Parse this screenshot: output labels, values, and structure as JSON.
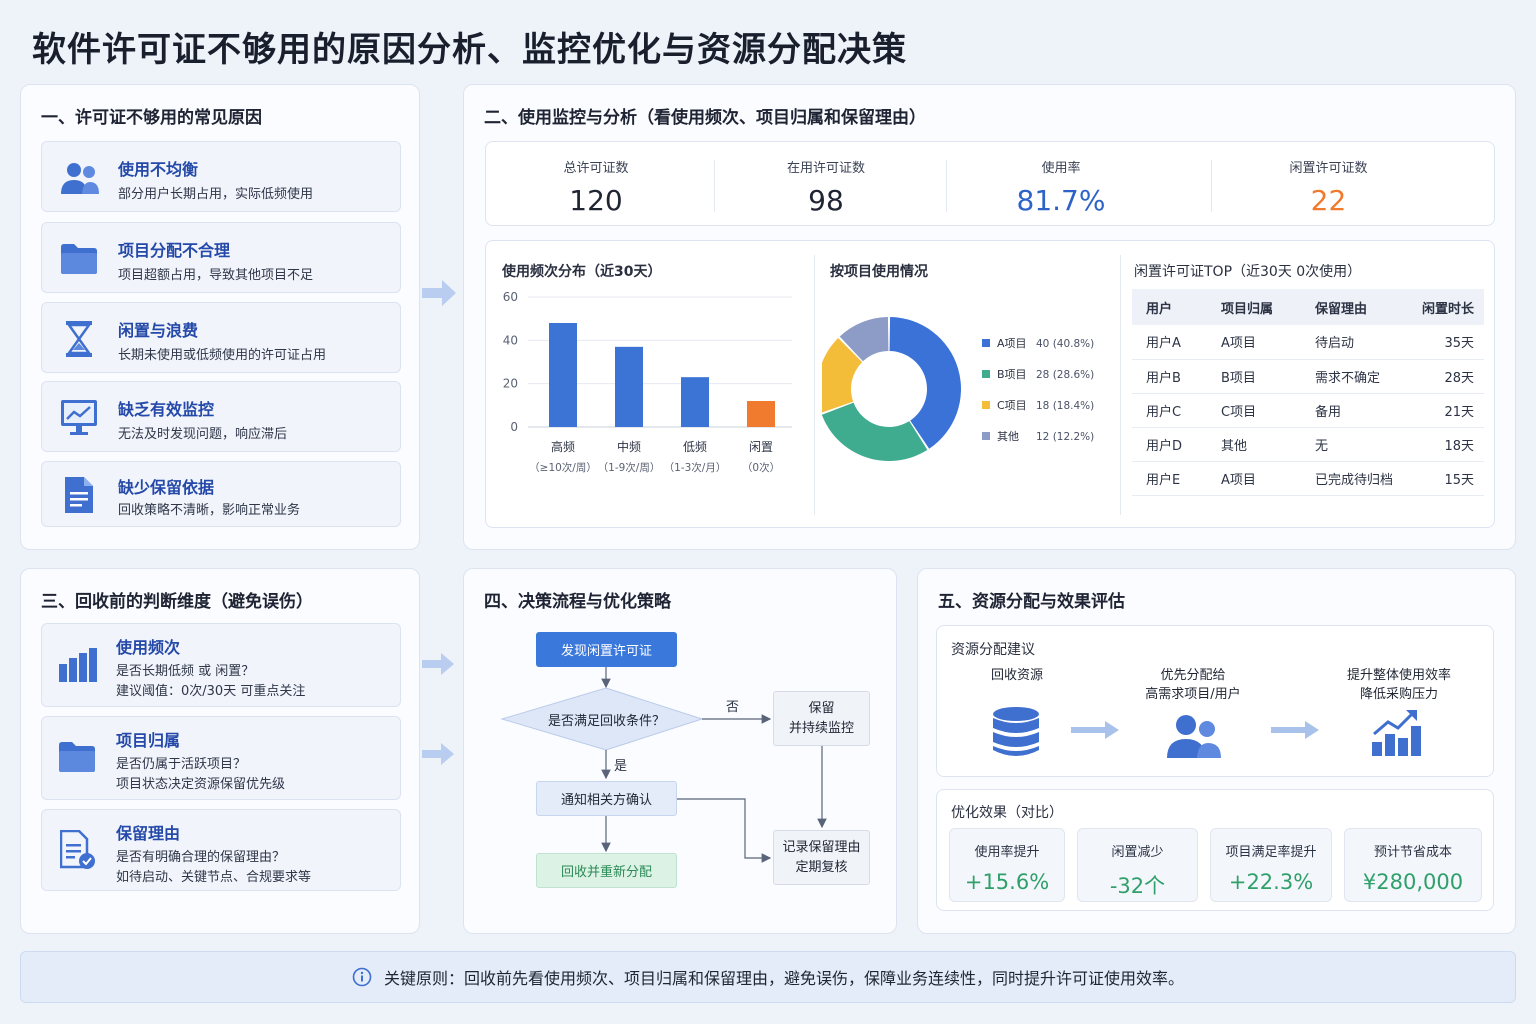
{
  "title": "软件许可证不够用的原因分析、监控优化与资源分配决策",
  "section1": {
    "title": "一、许可证不够用的常见原因",
    "items": [
      {
        "icon": "users-icon",
        "title": "使用不均衡",
        "desc": "部分用户长期占用，实际低频使用"
      },
      {
        "icon": "folder-icon",
        "title": "项目分配不合理",
        "desc": "项目超额占用，导致其他项目不足"
      },
      {
        "icon": "hourglass-icon",
        "title": "闲置与浪费",
        "desc": "长期未使用或低频使用的许可证占用"
      },
      {
        "icon": "monitor-chart-icon",
        "title": "缺乏有效监控",
        "desc": "无法及时发现问题，响应滞后"
      },
      {
        "icon": "document-icon",
        "title": "缺少保留依据",
        "desc": "回收策略不清晰，影响正常业务"
      }
    ]
  },
  "section2": {
    "title": "二、使用监控与分析（看使用频次、项目归属和保留理由）",
    "kpis": [
      {
        "label": "总许可证数",
        "value": "120",
        "color": "#1f2533"
      },
      {
        "label": "在用许可证数",
        "value": "98",
        "color": "#1f2533"
      },
      {
        "label": "使用率",
        "value": "81.7%",
        "color": "#2d63c8"
      },
      {
        "label": "闲置许可证数",
        "value": "22",
        "color": "#f07a2e"
      }
    ],
    "bar_title": "使用频次分布（近30天）",
    "donut_title": "按项目使用情况",
    "table_title": "闲置许可证TOP（近30天 0次使用）",
    "table": {
      "headers": [
        "用户",
        "项目归属",
        "保留理由",
        "闲置时长"
      ],
      "rows": [
        [
          "用户A",
          "A项目",
          "待启动",
          "35天"
        ],
        [
          "用户B",
          "B项目",
          "需求不确定",
          "28天"
        ],
        [
          "用户C",
          "C项目",
          "备用",
          "21天"
        ],
        [
          "用户D",
          "其他",
          "无",
          "18天"
        ],
        [
          "用户E",
          "A项目",
          "已完成待归档",
          "15天"
        ]
      ]
    }
  },
  "chart_data": [
    {
      "type": "bar",
      "title": "使用频次分布（近30天）",
      "categories": [
        "高频",
        "中频",
        "低频",
        "闲置"
      ],
      "category_notes": [
        "（≥10次/周）",
        "（1-9次/周）",
        "（1-3次/月）",
        "（0次）"
      ],
      "values": [
        48,
        37,
        23,
        12
      ],
      "colors": [
        "#3c74d6",
        "#3c74d6",
        "#3c74d6",
        "#f07a2e"
      ],
      "ylim": [
        0,
        60
      ],
      "yticks": [
        0,
        20,
        40,
        60
      ],
      "grid": true
    },
    {
      "type": "pie",
      "title": "按项目使用情况",
      "labels": [
        "A项目",
        "B项目",
        "C项目",
        "其他"
      ],
      "values": [
        40,
        28,
        18,
        12
      ],
      "percents": [
        "(40.8%)",
        "(28.6%)",
        "(18.4%)",
        "(12.2%)"
      ],
      "colors": [
        "#3a72d8",
        "#3fac90",
        "#f3bd3a",
        "#8d9bc7"
      ],
      "legend": "right"
    }
  ],
  "section3": {
    "title": "三、回收前的判断维度（避免误伤）",
    "items": [
      {
        "icon": "bar-chart-icon",
        "title": "使用频次",
        "lines": [
          "是否长期低频 或 闲置？",
          "建议阈值：0次/30天 可重点关注"
        ]
      },
      {
        "icon": "folder-icon",
        "title": "项目归属",
        "lines": [
          "是否仍属于活跃项目？",
          "项目状态决定资源保留优先级"
        ]
      },
      {
        "icon": "document-check-icon",
        "title": "保留理由",
        "lines": [
          "是否有明确合理的保留理由？",
          "如待启动、关键节点、合规要求等"
        ]
      }
    ]
  },
  "section4": {
    "title": "四、决策流程与优化策略",
    "flow": {
      "start": "发现闲置许可证",
      "decision": "是否满足回收条件？",
      "no_label": "否",
      "yes_label": "是",
      "keep": [
        "保留",
        "并持续监控"
      ],
      "notify": "通知相关方确认",
      "reclaim": "回收并重新分配",
      "record": [
        "记录保留理由",
        "定期复核"
      ]
    }
  },
  "section5": {
    "title": "五、资源分配与效果评估",
    "alloc_title": "资源分配建议",
    "alloc_steps": [
      {
        "icon": "database-icon",
        "lines": [
          "回收资源"
        ]
      },
      {
        "icon": "users-icon",
        "lines": [
          "优先分配给",
          "高需求项目/用户"
        ]
      },
      {
        "icon": "growth-chart-icon",
        "lines": [
          "提升整体使用效率",
          "降低采购压力"
        ]
      }
    ],
    "effect_title": "优化效果（对比）",
    "effects": [
      {
        "label": "使用率提升",
        "value": "+15.6%"
      },
      {
        "label": "闲置减少",
        "value": "-32个"
      },
      {
        "label": "项目满足率提升",
        "value": "+22.3%"
      },
      {
        "label": "预计节省成本",
        "value": "¥280,000"
      }
    ]
  },
  "footer": {
    "icon": "info-icon",
    "text": "关键原则：回收前先看使用频次、项目归属和保留理由，避免误伤，保障业务连续性，同时提升许可证使用效率。"
  }
}
